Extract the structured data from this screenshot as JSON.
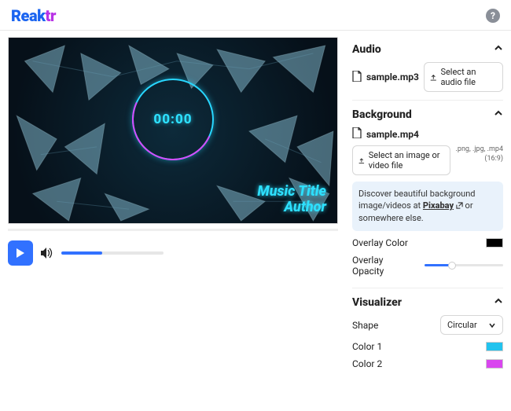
{
  "header": {
    "logo_part1": "Reak",
    "logo_part2": "tr",
    "help": "?"
  },
  "preview": {
    "timer": "00:00",
    "music_title": "Music Title",
    "author": "Author"
  },
  "controls": {
    "volume_fill_pct": 40
  },
  "audio": {
    "heading": "Audio",
    "filename": "sample.mp3",
    "select_label": "Select an audio file"
  },
  "background": {
    "heading": "Background",
    "filename": "sample.mp4",
    "select_label": "Select an image or video file",
    "hint": ".png, .jpg, .mp4 (16:9)",
    "info_pre": "Discover beautiful background image/videos at ",
    "info_link": "Pixabay",
    "info_post": " or somewhere else."
  },
  "overlay": {
    "color_label": "Overlay Color",
    "color_value": "#000000",
    "opacity_label": "Overlay Opacity",
    "opacity_pct": 35
  },
  "visualizer": {
    "heading": "Visualizer",
    "shape_label": "Shape",
    "shape_value": "Circular",
    "color1_label": "Color 1",
    "color1_value": "#22c3ee",
    "color2_label": "Color 2",
    "color2_value": "#d946ef"
  }
}
